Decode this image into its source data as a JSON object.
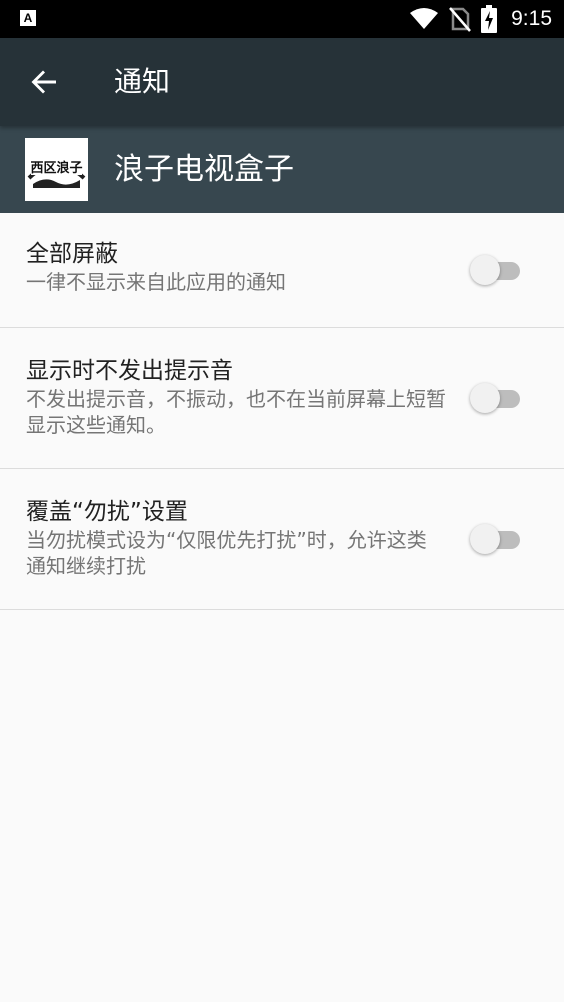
{
  "status_bar": {
    "notification_icon": "A",
    "time": "9:15",
    "icons": [
      "wifi-icon",
      "no-sim-icon",
      "battery-charging-icon"
    ]
  },
  "toolbar": {
    "back_icon": "arrow-back-icon",
    "title": "通知"
  },
  "app_header": {
    "app_name": "浪子电视盒子",
    "logo_text": "西区浪子"
  },
  "settings": [
    {
      "title": "全部屏蔽",
      "summary": "一律不显示来自此应用的通知",
      "enabled": false
    },
    {
      "title": "显示时不发出提示音",
      "summary": "不发出提示音，不振动，也不在当前屏幕上短暂显示这些通知。",
      "enabled": false
    },
    {
      "title": "覆盖“勿扰”设置",
      "summary": "当勿扰模式设为“仅限优先打扰”时，允许这类通知继续打扰",
      "enabled": false
    }
  ],
  "colors": {
    "toolbar": "#263238",
    "app_header": "#37474f",
    "background": "#fafafa",
    "switch_track_off": "#bdbdbd",
    "switch_thumb_off": "#f1f1f1"
  }
}
